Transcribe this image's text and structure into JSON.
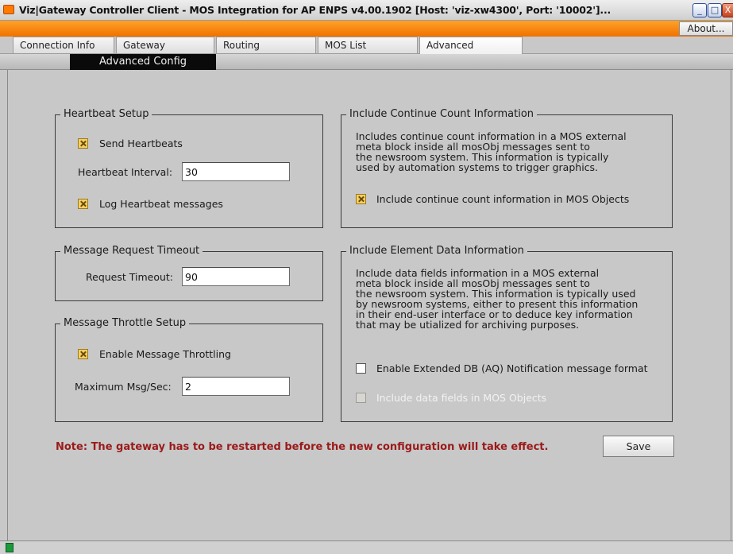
{
  "window": {
    "title": "Viz|Gateway Controller Client - MOS Integration for AP ENPS v4.00.1902   [Host: 'viz-xw4300', Port: '10002']...",
    "minimize_glyph": "_",
    "maximize_glyph": "□",
    "close_glyph": "X"
  },
  "menu": {
    "about_label": "About..."
  },
  "tabs": [
    {
      "label": "Connection Info"
    },
    {
      "label": "Gateway"
    },
    {
      "label": "Routing"
    },
    {
      "label": "MOS List"
    },
    {
      "label": "Advanced"
    }
  ],
  "active_tab": "Advanced",
  "subtab": {
    "label": "Advanced Config"
  },
  "heartbeat": {
    "legend": "Heartbeat Setup",
    "send_label": "Send Heartbeats",
    "send_checked": true,
    "interval_label": "Heartbeat Interval:",
    "interval_value": "30",
    "log_label": "Log Heartbeat messages",
    "log_checked": true
  },
  "request_timeout": {
    "legend": "Message Request Timeout",
    "label": "Request Timeout:",
    "value": "90"
  },
  "throttle": {
    "legend": "Message Throttle Setup",
    "enable_label": "Enable Message Throttling",
    "enable_checked": true,
    "max_label": "Maximum Msg/Sec:",
    "max_value": "2"
  },
  "continue_count": {
    "legend": "Include Continue Count Information",
    "desc": [
      "Includes continue count information in a MOS external",
      "meta block inside all mosObj messages sent to",
      "the newsroom system. This information is typically",
      "used by automation systems to trigger graphics."
    ],
    "include_label": "Include continue count information in MOS Objects",
    "include_checked": true
  },
  "element_data": {
    "legend": "Include Element Data Information",
    "desc": [
      "Include data fields information in a MOS external",
      "meta block inside all mosObj messages sent to",
      "the newsroom system. This information is typically used",
      "by newsroom systems, either to present this information",
      "in their end-user interface or to deduce key information",
      "that may be utialized for archiving purposes."
    ],
    "extended_label": "Enable Extended DB (AQ) Notification message format",
    "extended_checked": false,
    "fields_label": "Include data fields in MOS Objects",
    "fields_checked": false,
    "fields_disabled": true
  },
  "note": "Note: The gateway has to be restarted before the new configuration will take effect.",
  "save_label": "Save",
  "colors": {
    "accent_orange": "#f07100",
    "note_red": "#9b1a1a",
    "status_green": "#1a9a3a"
  }
}
